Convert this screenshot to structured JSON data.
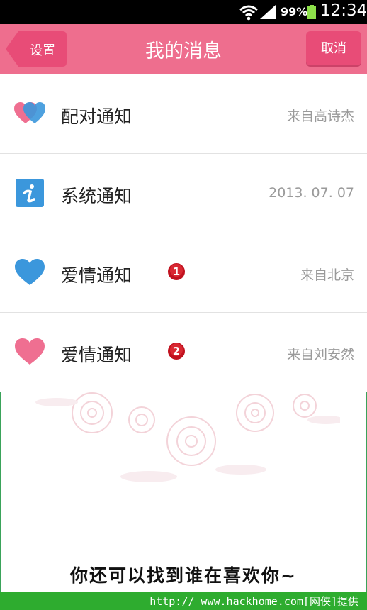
{
  "status_bar": {
    "battery_percent": "99%",
    "time": "12:34",
    "icons": [
      "wifi-icon",
      "signal-icon",
      "battery-icon"
    ]
  },
  "header": {
    "back_label": "设置",
    "title": "我的消息",
    "cancel_label": "取消",
    "color": "#ee6e8e"
  },
  "messages": [
    {
      "icon": "pair-hearts-icon",
      "label": "配对通知",
      "meta": "来自高诗杰",
      "badge": ""
    },
    {
      "icon": "info-icon",
      "label": "系统通知",
      "meta": "2013. 07. 07",
      "badge": ""
    },
    {
      "icon": "blue-heart-icon",
      "label": "爱情通知",
      "meta": "来自北京",
      "badge": "1"
    },
    {
      "icon": "pink-heart-icon",
      "label": "爱情通知",
      "meta": "来自刘安然",
      "badge": "2"
    }
  ],
  "slogan": "你还可以找到谁在喜欢你~",
  "watermark": "http:// www.hackhome.com[网侠]提供"
}
